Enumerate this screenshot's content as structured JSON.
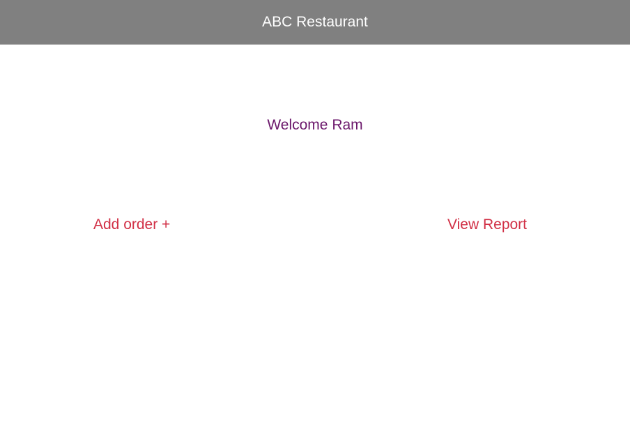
{
  "header": {
    "title": "ABC Restaurant",
    "background_color": "#808080",
    "text_color": "#ffffff"
  },
  "main": {
    "welcome_text": "Welcome Ram",
    "welcome_color": "#6b176b",
    "actions": {
      "add_order_label": "Add order +",
      "view_report_label": "View Report",
      "link_color": "#d12f45"
    }
  }
}
